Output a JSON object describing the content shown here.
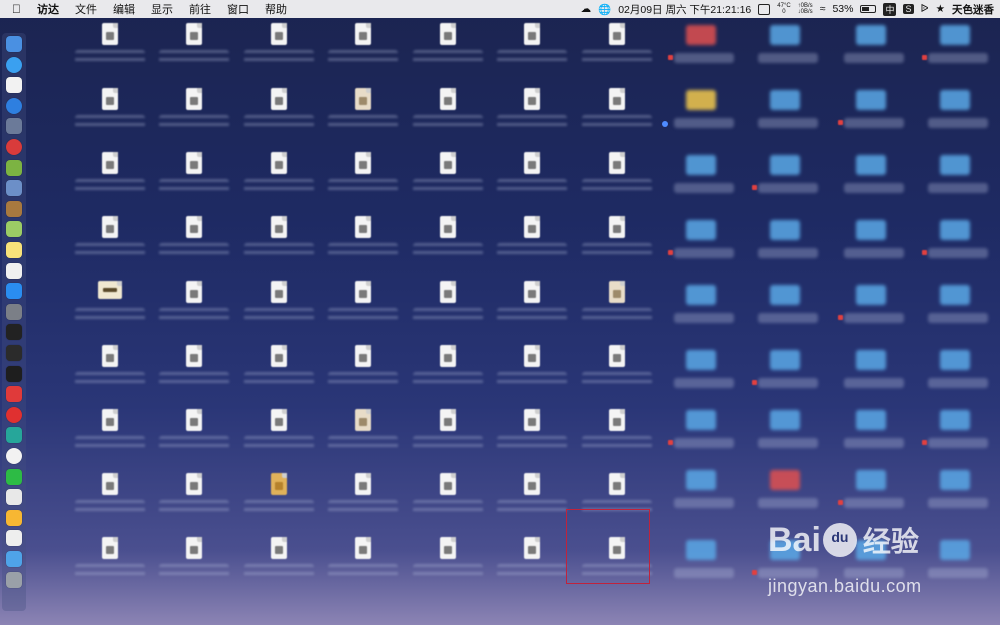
{
  "menubar": {
    "apple_icon": "apple-icon",
    "app_name": "访达",
    "menus": [
      "文件",
      "编辑",
      "显示",
      "前往",
      "窗口",
      "帮助"
    ],
    "date_time": "02月09日 周六 下午21:21:16",
    "temperature_top": "47°C",
    "temperature_bottom": "0",
    "net_up": "0B/s",
    "net_down": "0B/s",
    "battery_percent": "53%",
    "battery_level": 0.53,
    "input_method": "中",
    "user_name": "天色迷香"
  },
  "dock": {
    "items": [
      {
        "name": "finder-icon",
        "color": "#4a90e2"
      },
      {
        "name": "safari-icon",
        "color": "#3aa0f0"
      },
      {
        "name": "calendar-icon",
        "color": "#f2f2f2"
      },
      {
        "name": "compass-icon",
        "color": "#2e7fe0"
      },
      {
        "name": "launchpad-icon",
        "color": "#6b7a99"
      },
      {
        "name": "app-red-icon",
        "color": "#d93b3b"
      },
      {
        "name": "android-icon",
        "color": "#7cb342"
      },
      {
        "name": "preview-icon",
        "color": "#6c8fc8"
      },
      {
        "name": "notebook-icon",
        "color": "#a8793f"
      },
      {
        "name": "maps-icon",
        "color": "#9ccc65"
      },
      {
        "name": "notes-icon",
        "color": "#f8e27a"
      },
      {
        "name": "textedit-icon",
        "color": "#f0f0f0"
      },
      {
        "name": "appstore-icon",
        "color": "#2a8df0"
      },
      {
        "name": "system-preferences-icon",
        "color": "#7b7f87"
      },
      {
        "name": "activity-monitor-icon",
        "color": "#222222"
      },
      {
        "name": "console-icon",
        "color": "#2b2b2b"
      },
      {
        "name": "terminal-icon",
        "color": "#1e1e1e"
      },
      {
        "name": "vivaldi-icon",
        "color": "#e03a3a"
      },
      {
        "name": "netease-music-icon",
        "color": "#e03030"
      },
      {
        "name": "sync-icon",
        "color": "#26a69a"
      },
      {
        "name": "yandex-icon",
        "color": "#f2f2f2"
      },
      {
        "name": "wechat-icon",
        "color": "#2dbb45"
      },
      {
        "name": "script-editor-icon",
        "color": "#e8e8e8"
      },
      {
        "name": "sketch-icon",
        "color": "#f7b733"
      },
      {
        "name": "document-icon",
        "color": "#eeeeee"
      },
      {
        "name": "downloads-folder-icon",
        "color": "#4fa3e8"
      },
      {
        "name": "trash-icon",
        "color": "#9aa0a8"
      }
    ]
  },
  "desktop": {
    "columns": 7,
    "rows": 9,
    "special_files": {
      "0-4": "back",
      "3-1": "sheep",
      "3-6": "sheep",
      "6-4": "sheep",
      "2-7": "pkg"
    }
  },
  "right_panel": {
    "folder_color": "#5aa8e6",
    "red_folder_color": "#e05050",
    "yellow_folder_color": "#f2c94c"
  },
  "highlight": {
    "color": "#c0233c"
  },
  "watermark": {
    "brand_left": "Bai",
    "brand_right": "经验",
    "url": "jingyan.baidu.com"
  }
}
